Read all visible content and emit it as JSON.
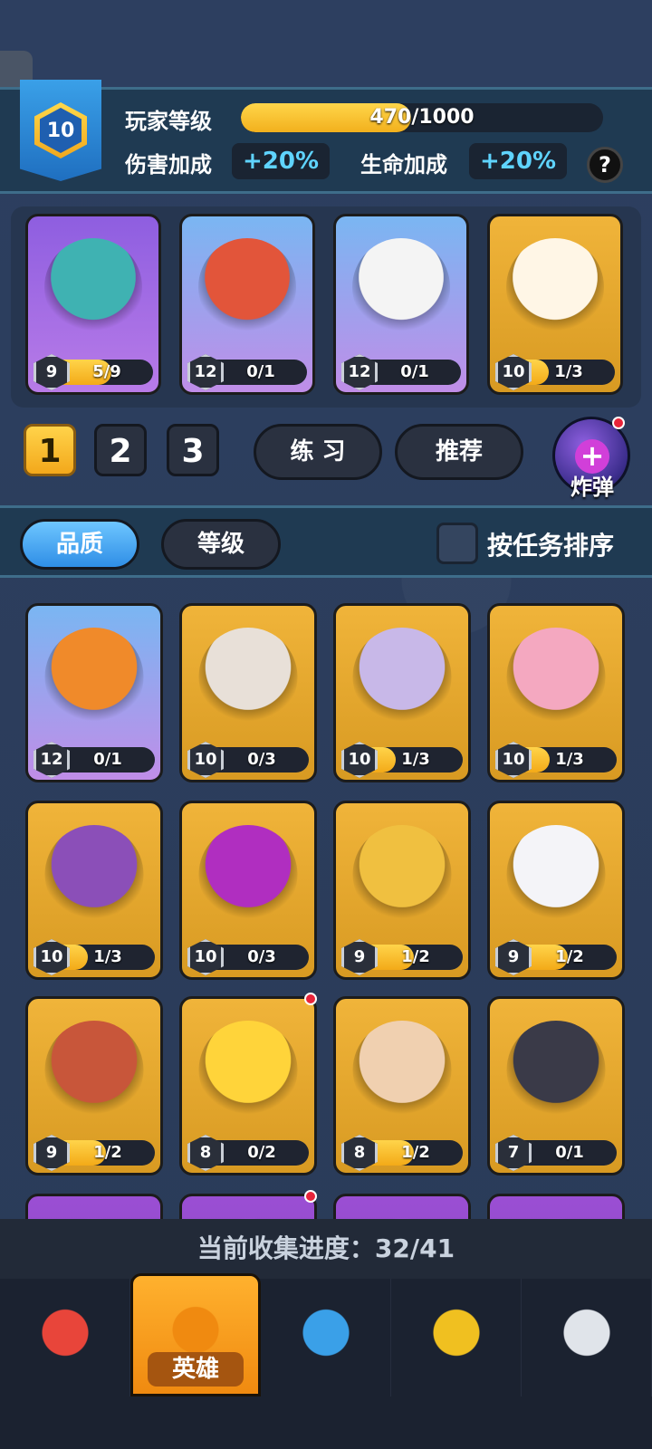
{
  "player": {
    "level": "10",
    "level_label": "玩家等级",
    "xp_text": "470/1000",
    "xp_progress": 0.47,
    "damage_label": "伤害加成",
    "damage_value": "+20%",
    "health_label": "生命加成",
    "health_value": "+20%",
    "help": "?"
  },
  "side_tab": {
    "icon": "chevron-right-icon",
    "glyph": "›"
  },
  "team": [
    {
      "level": "9",
      "count": "5/9",
      "progress": 0.56,
      "frame": "purple",
      "hero": "blue-ogre-hook"
    },
    {
      "level": "12",
      "count": "0/1",
      "progress": 0.0,
      "frame": "blue",
      "hero": "red-chef-creature"
    },
    {
      "level": "12",
      "count": "0/1",
      "progress": 0.0,
      "frame": "blue",
      "hero": "panda-warrior"
    },
    {
      "level": "10",
      "count": "1/3",
      "progress": 0.33,
      "frame": "gold",
      "hero": "white-fox-mage"
    }
  ],
  "team_tabs": {
    "t1": "1",
    "t2": "2",
    "t3": "3",
    "active": 0
  },
  "buttons": {
    "practice": "练 习",
    "recommend": "推荐",
    "bomb": "炸弹"
  },
  "filters": {
    "quality": "品质",
    "level": "等级",
    "sort_by_task": "按任务排序"
  },
  "heroes": [
    {
      "level": "12",
      "count": "0/1",
      "progress": 0.0,
      "frame": "blue",
      "hero": "pumpkin-magician",
      "dot": false
    },
    {
      "level": "10",
      "count": "0/3",
      "progress": 0.0,
      "frame": "gold",
      "hero": "feathered-shaman",
      "dot": false
    },
    {
      "level": "10",
      "count": "1/3",
      "progress": 0.33,
      "frame": "gold",
      "hero": "white-haired-maid",
      "dot": false
    },
    {
      "level": "10",
      "count": "1/3",
      "progress": 0.33,
      "frame": "gold",
      "hero": "pink-hair-girl",
      "dot": false
    },
    {
      "level": "10",
      "count": "1/3",
      "progress": 0.33,
      "frame": "gold",
      "hero": "purple-bat",
      "dot": false
    },
    {
      "level": "10",
      "count": "0/3",
      "progress": 0.0,
      "frame": "gold",
      "hero": "purple-spider",
      "dot": false
    },
    {
      "level": "9",
      "count": "1/2",
      "progress": 0.5,
      "frame": "gold",
      "hero": "knight-helmet",
      "dot": false
    },
    {
      "level": "9",
      "count": "1/2",
      "progress": 0.5,
      "frame": "gold",
      "hero": "cloud-spirit",
      "dot": false
    },
    {
      "level": "9",
      "count": "1/2",
      "progress": 0.5,
      "frame": "gold",
      "hero": "tribal-warrior",
      "dot": false
    },
    {
      "level": "8",
      "count": "0/2",
      "progress": 0.0,
      "frame": "gold",
      "hero": "chicken-boxer",
      "dot": true
    },
    {
      "level": "8",
      "count": "1/2",
      "progress": 0.5,
      "frame": "gold",
      "hero": "old-engineer",
      "dot": false
    },
    {
      "level": "7",
      "count": "0/1",
      "progress": 0.0,
      "frame": "gold",
      "hero": "black-wolf",
      "dot": false
    },
    {
      "level": "",
      "count": "",
      "progress": 0.0,
      "frame": "violet",
      "hero": "partial",
      "dot": false
    },
    {
      "level": "",
      "count": "",
      "progress": 0.0,
      "frame": "violet",
      "hero": "partial",
      "dot": true
    },
    {
      "level": "",
      "count": "",
      "progress": 0.0,
      "frame": "violet",
      "hero": "partial",
      "dot": false
    },
    {
      "level": "",
      "count": "",
      "progress": 0.0,
      "frame": "violet",
      "hero": "partial",
      "dot": false
    }
  ],
  "collection": "当前收集进度：32/41",
  "nav": [
    {
      "name": "shop",
      "icon": "shop-stall-icon",
      "label": ""
    },
    {
      "name": "heroes",
      "icon": "hero-cards-icon",
      "label": "英雄"
    },
    {
      "name": "battle",
      "icon": "crossed-swords-icon",
      "label": ""
    },
    {
      "name": "guild",
      "icon": "shield-crest-icon",
      "label": ""
    },
    {
      "name": "gear",
      "icon": "gauntlet-icon",
      "label": ""
    }
  ],
  "colors": {
    "accent_gold": "#f3aa18",
    "accent_blue": "#5fd4ff",
    "panel": "#1f3a52"
  }
}
